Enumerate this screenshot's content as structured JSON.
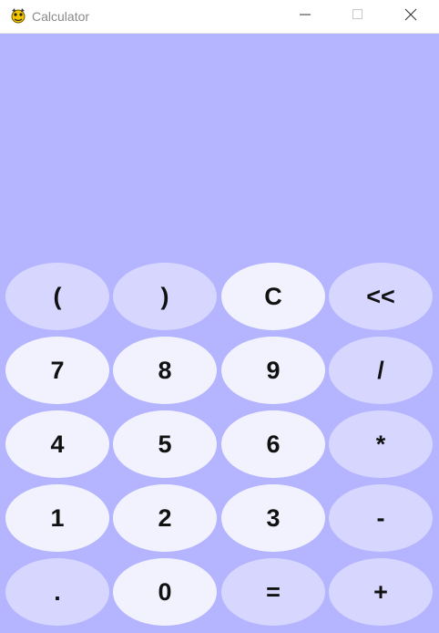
{
  "window": {
    "title": "Calculator",
    "colors": {
      "background": "#b4b4ff",
      "key_light": "#f2f2ff",
      "key_dim": "#d6d6ff",
      "titlebar": "#ffffff"
    }
  },
  "display": {
    "value": ""
  },
  "keypad": {
    "rows": [
      [
        {
          "label": "(",
          "style": "dim"
        },
        {
          "label": ")",
          "style": "dim"
        },
        {
          "label": "C",
          "style": "light"
        },
        {
          "label": "<<",
          "style": "dim"
        }
      ],
      [
        {
          "label": "7",
          "style": "light"
        },
        {
          "label": "8",
          "style": "light"
        },
        {
          "label": "9",
          "style": "light"
        },
        {
          "label": "/",
          "style": "dim"
        }
      ],
      [
        {
          "label": "4",
          "style": "light"
        },
        {
          "label": "5",
          "style": "light"
        },
        {
          "label": "6",
          "style": "light"
        },
        {
          "label": "*",
          "style": "dim"
        }
      ],
      [
        {
          "label": "1",
          "style": "light"
        },
        {
          "label": "2",
          "style": "light"
        },
        {
          "label": "3",
          "style": "light"
        },
        {
          "label": "-",
          "style": "dim"
        }
      ],
      [
        {
          "label": ".",
          "style": "dim"
        },
        {
          "label": "0",
          "style": "light"
        },
        {
          "label": "=",
          "style": "dim"
        },
        {
          "label": "+",
          "style": "dim"
        }
      ]
    ]
  }
}
